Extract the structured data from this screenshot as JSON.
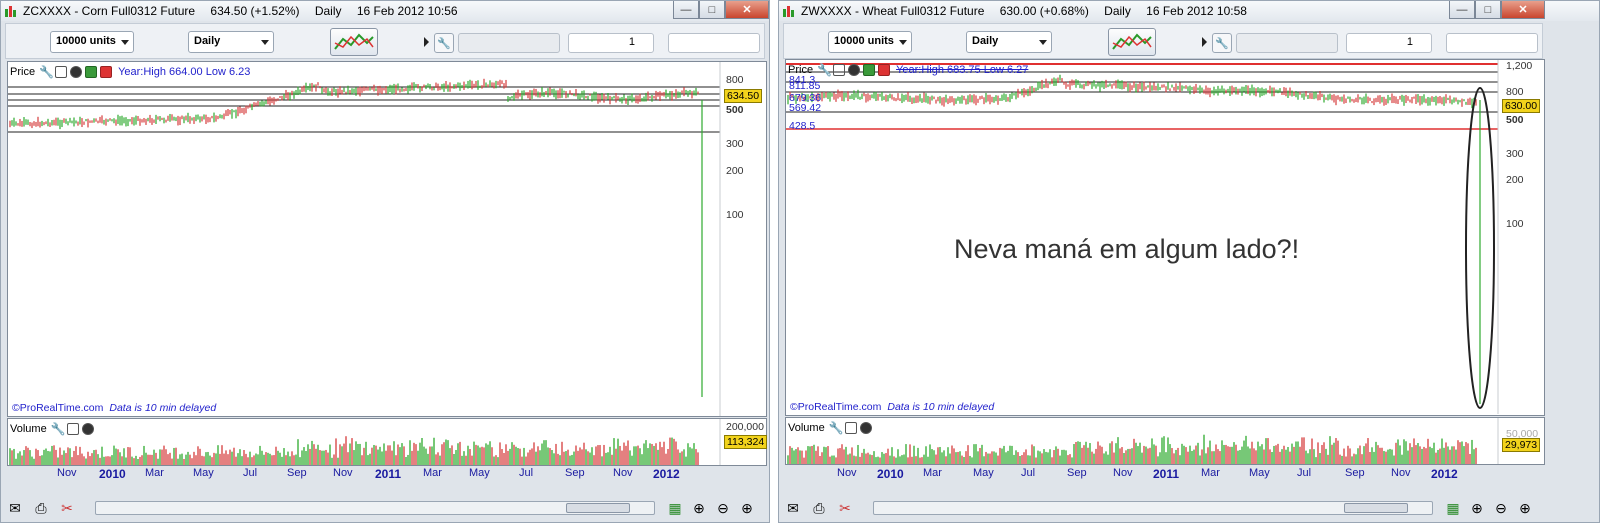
{
  "windows": [
    {
      "title": {
        "symbol": "ZCXXXX - Corn Full0312 Future",
        "quote": "634.50 (+1.52%)",
        "period": "Daily",
        "datetime": "16 Feb 2012 10:56"
      },
      "toolbar": {
        "units": "10000 units",
        "period": "Daily",
        "qty": "1"
      },
      "price_panel": {
        "label": "Price",
        "year_info": "Year:High 664.00 Low 6.23",
        "price_tag": "634.50",
        "y_axis": [
          "800",
          "500",
          "300",
          "200",
          "100"
        ],
        "level_labels": []
      },
      "credit": {
        "site": "©ProRealTime.com",
        "delay": "Data is 10 min delayed"
      },
      "volume_panel": {
        "label": "Volume",
        "top_tick": "200,000",
        "value_tag": "113,324"
      },
      "x_axis": [
        "Nov",
        "2010",
        "Mar",
        "May",
        "Jul",
        "Sep",
        "Nov",
        "2011",
        "Mar",
        "May",
        "Jul",
        "Sep",
        "Nov",
        "2012"
      ],
      "annotation": ""
    },
    {
      "title": {
        "symbol": "ZWXXXX - Wheat Full0312 Future",
        "quote": "630.00 (+0.68%)",
        "period": "Daily",
        "datetime": "16 Feb 2012 10:58"
      },
      "toolbar": {
        "units": "10000 units",
        "period": "Daily",
        "qty": "1"
      },
      "price_panel": {
        "label": "Price",
        "year_info": "Year:High 683.75 Low 6.27",
        "price_tag": "630.00",
        "y_axis": [
          "1,200",
          "800",
          "500",
          "300",
          "200",
          "100"
        ],
        "level_labels": [
          "841.3",
          "811.85",
          "679.36",
          "569.42",
          "428.5"
        ]
      },
      "credit": {
        "site": "©ProRealTime.com",
        "delay": "Data is 10 min delayed"
      },
      "volume_panel": {
        "label": "Volume",
        "top_tick": "50,000",
        "value_tag": "29,973"
      },
      "x_axis": [
        "Nov",
        "2010",
        "Mar",
        "May",
        "Jul",
        "Sep",
        "Nov",
        "2011",
        "Mar",
        "May",
        "Jul",
        "Sep",
        "Nov",
        "2012"
      ],
      "annotation": "Neva maná em algum lado?!"
    }
  ],
  "colors": {
    "up": "#2eaa2e",
    "down": "#d63c3c",
    "level_line": "#222222",
    "red_line": "#e03030",
    "price_tag": "#f2d31c"
  }
}
